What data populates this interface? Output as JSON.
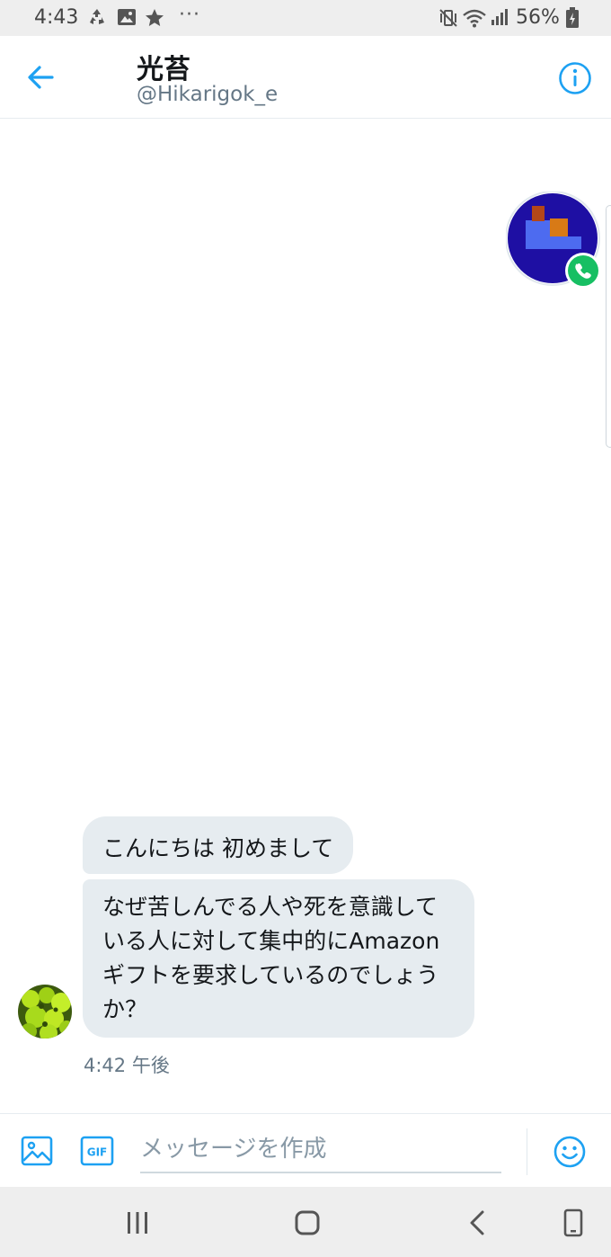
{
  "status_bar": {
    "time": "4:43",
    "overflow_dots": "···",
    "battery_percent": "56%",
    "icons": [
      "recycle-icon",
      "gallery-icon",
      "star-icon",
      "mute-vibrate-icon",
      "wifi-icon",
      "signal-icon",
      "battery-charging-icon"
    ]
  },
  "header": {
    "display_name": "光苔",
    "handle": "@Hikarigok_e",
    "back_icon": "arrow-left-icon",
    "info_icon": "info-icon"
  },
  "conversation": {
    "messages": [
      {
        "text": "こんにちは 初めまして"
      },
      {
        "text": "なぜ苦しんでる人や死を意識している人に対して集中的にAmazonギフトを要求しているのでしょうか？"
      }
    ],
    "timestamp": "4:42 午後"
  },
  "composer": {
    "placeholder": "メッセージを作成",
    "value": "",
    "gif_label": "GIF",
    "media_icon": "image-icon",
    "emoji_icon": "smiley-icon"
  },
  "colors": {
    "accent": "#1da1f2",
    "bubble": "#e6ecf0",
    "call_badge": "#17bf63"
  },
  "nav_bar": {
    "icons": [
      "recent-apps-icon",
      "home-icon",
      "back-icon",
      "screen-rotate-icon"
    ]
  }
}
